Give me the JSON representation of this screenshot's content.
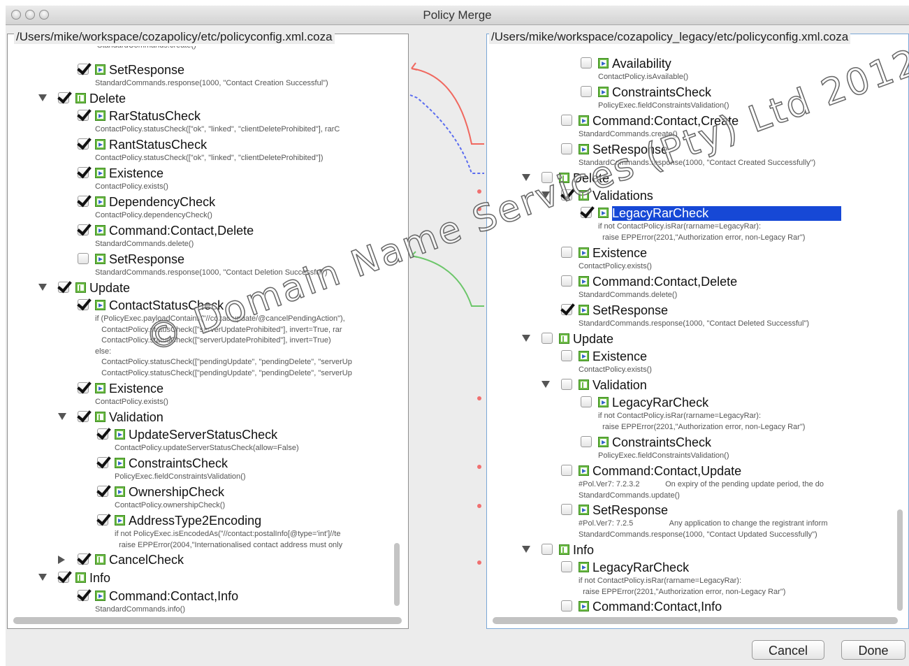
{
  "window": {
    "title": "Policy Merge"
  },
  "left": {
    "path": "/Users/mike/workspace/cozapolicy/etc/policyconfig.xml.coza",
    "rows": [
      {
        "sub": "StandardCommands.create()"
      },
      {
        "checked": true,
        "kind": "rule",
        "label": "SetResponse",
        "sub": "StandardCommands.response(1000, \"Contact Creation Successful\")"
      },
      {
        "checked": true,
        "kind": "group",
        "label": "Delete",
        "toggle": "down"
      },
      {
        "checked": true,
        "kind": "rule",
        "label": "RarStatusCheck",
        "sub": "ContactPolicy.statusCheck([\"ok\", \"linked\", \"clientDeleteProhibited\"], rarC"
      },
      {
        "checked": true,
        "kind": "rule",
        "label": "RantStatusCheck",
        "sub": "ContactPolicy.statusCheck([\"ok\", \"linked\", \"clientDeleteProhibited\"])"
      },
      {
        "checked": true,
        "kind": "rule",
        "label": "Existence",
        "sub": "ContactPolicy.exists()"
      },
      {
        "checked": true,
        "kind": "rule",
        "label": "DependencyCheck",
        "sub": "ContactPolicy.dependencyCheck()"
      },
      {
        "checked": true,
        "kind": "rule",
        "label": "Command:Contact,Delete",
        "sub": "StandardCommands.delete()"
      },
      {
        "checked": false,
        "kind": "rule",
        "label": "SetResponse",
        "sub": "StandardCommands.response(1000, \"Contact Deletion Successful\")"
      },
      {
        "checked": true,
        "kind": "group",
        "label": "Update",
        "toggle": "down"
      },
      {
        "checked": true,
        "kind": "rule",
        "label": "ContactStatusCheck",
        "sub": "if (PolicyExec.payloadContains(\"//cozac:update/@cancelPendingAction\"),\n   ContactPolicy.statusCheck([\"serverUpdateProhibited\"], invert=True, rar\n   ContactPolicy.statusCheck([\"serverUpdateProhibited\"], invert=True)\nelse:\n   ContactPolicy.statusCheck([\"pendingUpdate\", \"pendingDelete\", \"serverUp\n   ContactPolicy.statusCheck([\"pendingUpdate\", \"pendingDelete\", \"serverUp"
      },
      {
        "checked": true,
        "kind": "rule",
        "label": "Existence",
        "sub": "ContactPolicy.exists()"
      },
      {
        "checked": true,
        "kind": "group",
        "label": "Validation",
        "toggle": "down"
      },
      {
        "checked": true,
        "kind": "rule",
        "label": "UpdateServerStatusCheck",
        "sub": "ContactPolicy.updateServerStatusCheck(allow=False)"
      },
      {
        "checked": true,
        "kind": "rule",
        "label": "ConstraintsCheck",
        "sub": "PolicyExec.fieldConstraintsValidation()"
      },
      {
        "checked": true,
        "kind": "rule",
        "label": "OwnershipCheck",
        "sub": "ContactPolicy.ownershipCheck()"
      },
      {
        "checked": true,
        "kind": "rule",
        "label": "AddressType2Encoding",
        "sub": "if not PolicyExec.isEncodedAs(\"//contact:postalInfo[@type='int']//te\n  raise EPPError(2004,\"Internationalised contact address must only"
      },
      {
        "checked": true,
        "kind": "group",
        "label": "CancelCheck",
        "toggle": "right"
      },
      {
        "checked": true,
        "kind": "group",
        "label": "Info",
        "toggle": "down"
      },
      {
        "checked": true,
        "kind": "rule",
        "label": "Command:Contact,Info",
        "sub": "StandardCommands.info()"
      }
    ]
  },
  "right": {
    "path": "/Users/mike/workspace/cozapolicy_legacy/etc/policyconfig.xml.coza",
    "rows": [
      {
        "checked": false,
        "kind": "rule",
        "label": "Availability",
        "sub": "ContactPolicy.isAvailable()"
      },
      {
        "checked": false,
        "kind": "rule",
        "label": "ConstraintsCheck",
        "sub": "PolicyExec.fieldConstraintsValidation()"
      },
      {
        "checked": false,
        "kind": "rule",
        "label": "Command:Contact,Create",
        "sub": "StandardCommands.create()"
      },
      {
        "checked": false,
        "kind": "rule",
        "label": "SetResponse",
        "sub": "StandardCommands.response(1000, \"Contact Created Successfully\")"
      },
      {
        "checked": false,
        "kind": "group",
        "label": "Delete",
        "toggle": "down"
      },
      {
        "checked": true,
        "kind": "group",
        "label": "Validations",
        "toggle": "down"
      },
      {
        "checked": true,
        "kind": "rule",
        "label": "LegacyRarCheck",
        "selected": true,
        "sub": "if not ContactPolicy.isRar(rarname=LegacyRar):\n  raise EPPError(2201,\"Authorization error, non-Legacy Rar\")"
      },
      {
        "checked": false,
        "kind": "rule",
        "label": "Existence",
        "sub": "ContactPolicy.exists()"
      },
      {
        "checked": false,
        "kind": "rule",
        "label": "Command:Contact,Delete",
        "sub": "StandardCommands.delete()"
      },
      {
        "checked": true,
        "kind": "rule",
        "label": "SetResponse",
        "sub": "StandardCommands.response(1000, \"Contact Deleted Successful\")"
      },
      {
        "checked": false,
        "kind": "group",
        "label": "Update",
        "toggle": "down"
      },
      {
        "checked": false,
        "kind": "rule",
        "label": "Existence",
        "sub": "ContactPolicy.exists()"
      },
      {
        "checked": false,
        "kind": "group",
        "label": "Validation",
        "toggle": "down"
      },
      {
        "checked": false,
        "kind": "rule",
        "label": "LegacyRarCheck",
        "sub": "if not ContactPolicy.isRar(rarname=LegacyRar):\n  raise EPPError(2201,\"Authorization error, non-Legacy Rar\")"
      },
      {
        "checked": false,
        "kind": "rule",
        "label": "ConstraintsCheck",
        "sub": "PolicyExec.fieldConstraintsValidation()"
      },
      {
        "checked": false,
        "kind": "rule",
        "label": "Command:Contact,Update",
        "sub": "#Pol.Ver7: 7.2.3.2            On expiry of the pending update period, the do\nStandardCommands.update()"
      },
      {
        "checked": false,
        "kind": "rule",
        "label": "SetResponse",
        "sub": "#Pol.Ver7: 7.2.5                 Any application to change the registrant inform\nStandardCommands.response(1000, \"Contact Updated Successfully\")"
      },
      {
        "checked": false,
        "kind": "group",
        "label": "Info",
        "toggle": "down"
      },
      {
        "checked": false,
        "kind": "rule",
        "label": "LegacyRarCheck",
        "sub": "if not ContactPolicy.isRar(rarname=LegacyRar):\n  raise EPPError(2201,\"Authorization error, non-Legacy Rar\")"
      },
      {
        "checked": false,
        "kind": "rule",
        "label": "Command:Contact,Info"
      }
    ]
  },
  "buttons": {
    "cancel": "Cancel",
    "done": "Done"
  },
  "watermark": "© Domain Name Services (Pty) Ltd 2012",
  "colors": {
    "selection": "#1648d6",
    "link_red": "#f0685f",
    "link_blue": "#5a6cf0",
    "link_green": "#6cc66a",
    "marker": "#f07070"
  }
}
